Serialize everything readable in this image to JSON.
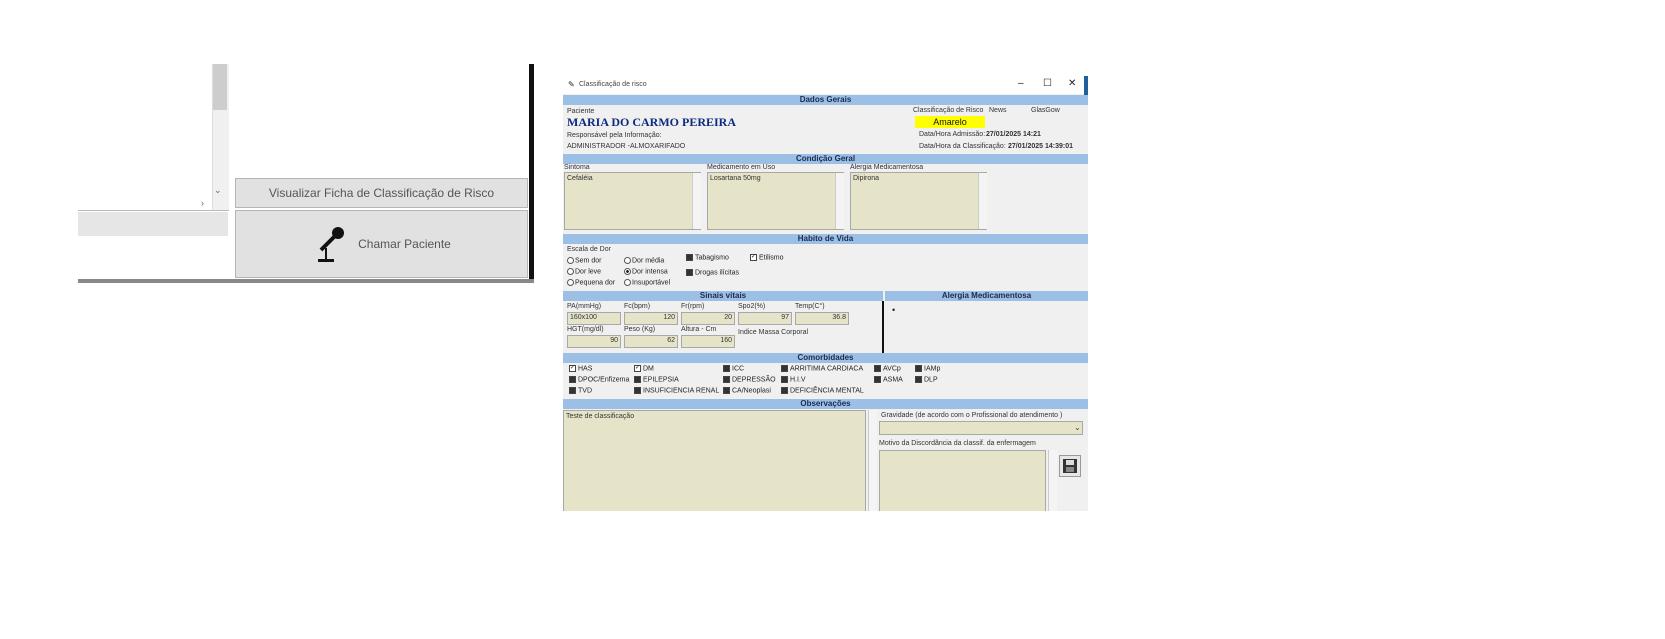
{
  "left": {
    "view_button": "Visualizar Ficha de Classificação de Risco",
    "call_button": "Chamar Paciente"
  },
  "dialog": {
    "title": "Classificação de risco",
    "sections": {
      "general": "Dados Gerais",
      "condition": "Condição Geral",
      "habits": "Habito de Vida",
      "vitals": "Sinais vitais",
      "allergy_side": "Alergia Medicamentosa",
      "comorb": "Comorbidades",
      "obs": "Observações"
    },
    "patient": {
      "label": "Paciente",
      "name": "MARIA DO CARMO PEREIRA",
      "resp_label": "Responsável pela Informação:",
      "resp_value": "ADMINISTRADOR -ALMOXARIFADO"
    },
    "risk": {
      "label": "Classificação de Risco",
      "news_label": "News",
      "glasgow_label": "GlasGow",
      "value": "Amarelo",
      "admission_label": "Data/Hora Admissão:",
      "admission_value": "27/01/2025 14:21",
      "class_label": "Data/Hora da Classificação:",
      "class_value": "27/01/2025 14:39:01"
    },
    "condition": {
      "symptom_label": "Sintoma",
      "symptom_value": "Cefaléia",
      "meds_label": "Medicamento em Uso",
      "meds_value": "Losartana 50mg",
      "allergy_label": "Alergia Medicamentosa",
      "allergy_value": "Dipirona"
    },
    "pain": {
      "label": "Escala de Dor",
      "options": [
        "Sem dor",
        "Dor leve",
        "Pequena dor",
        "Dor média",
        "Dor intensa",
        "Insuportável"
      ]
    },
    "habits": {
      "tabagismo": "Tabagismo",
      "etilismo": "Etilismo",
      "drogas": "Drogas ilícitas"
    },
    "vitals": {
      "pa_label": "PA(mmHg)",
      "pa_value": "160x100",
      "fc_label": "Fc(bpm)",
      "fc_value": "120",
      "fr_label": "Fr(rpm)",
      "fr_value": "20",
      "spo2_label": "Spo2(%)",
      "spo2_value": "97",
      "temp_label": "Temp(C°)",
      "temp_value": "36.8",
      "hgt_label": "HGT(mg/dl)",
      "hgt_value": "90",
      "peso_label": "Peso (Kg)",
      "peso_value": "62",
      "altura_label": "Altura - Cm",
      "altura_value": "160",
      "imc_label": "Indice Massa Corporal",
      "allergy_bullet": "•"
    },
    "comorb": {
      "items": [
        "HAS",
        "DM",
        "ICC",
        "ARRITIMIA CARDIACA",
        "AVCp",
        "IAMp",
        "DPOC/Enfizema",
        "EPILEPSIA",
        "DEPRESSÃO",
        "H.I.V",
        "ASMA",
        "DLP",
        "TVD",
        "INSUFICIENCIA RENAL",
        "CA/Neoplasi",
        "DEFICIÊNCIA MENTAL"
      ]
    },
    "obs": {
      "text": "Teste de classificação",
      "gravity_label": "Gravidade (de acordo com o Profissional do atendimento )",
      "discord_label": "Motivo da Discordância da classif. da enfermagem"
    }
  }
}
